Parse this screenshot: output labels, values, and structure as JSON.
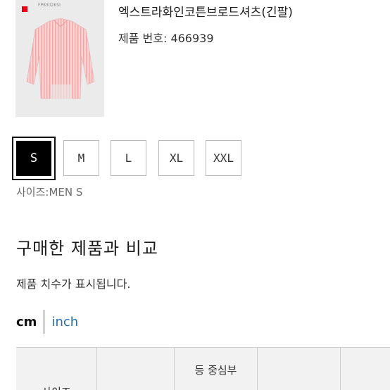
{
  "product": {
    "thumbnail_note": "FP8302KSI",
    "name": "엑스트라화인코튼브로드셔츠(긴팔)",
    "number": "제품 번호: 466939"
  },
  "sizes": {
    "options": [
      "S",
      "M",
      "L",
      "XL",
      "XXL"
    ],
    "selected": "S",
    "caption": "사이즈:MEN S"
  },
  "compare": {
    "title": "구매한 제품과 비교",
    "description": "제품 치수가 표시됩니다."
  },
  "units": {
    "cm": "cm",
    "inch": "inch",
    "active": "cm"
  },
  "table": {
    "headers": [
      {
        "line1": "사이즈",
        "line2": ""
      },
      {
        "line1": "",
        "line2": ""
      },
      {
        "line1": "등 중심부",
        "line2": ""
      },
      {
        "line1": "",
        "line2": ""
      },
      {
        "line1": "",
        "line2": ""
      }
    ]
  },
  "colors": {
    "selected_bg": "#000000",
    "inch_link": "#2a6fa8",
    "brand_red": "#e60012"
  }
}
